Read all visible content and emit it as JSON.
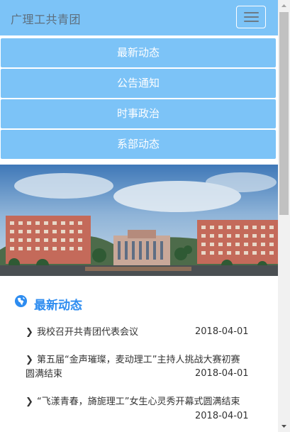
{
  "navbar": {
    "brand": "广理工共青团",
    "toggle_icon": "hamburger-icon",
    "bg_color": "#7cc3f7"
  },
  "menu": {
    "items": [
      {
        "label": "最新动态"
      },
      {
        "label": "公告通知"
      },
      {
        "label": "时事政治"
      },
      {
        "label": "系部动态"
      }
    ]
  },
  "banner": {
    "icon": "campus-photo"
  },
  "news": {
    "title": "最新动态",
    "title_icon": "globe-icon",
    "title_color": "#2d8cf0",
    "items": [
      {
        "text": "我校召开共青团代表会议",
        "date": "2018-04-01"
      },
      {
        "text": "第五届“金声璀璨，麦动理工”主持人挑战大赛初赛圆满结束",
        "date": "2018-04-01"
      },
      {
        "text": "“飞漾青春，旖旎理工”女生心灵秀开幕式圆满结束",
        "date": "2018-04-01"
      }
    ]
  }
}
